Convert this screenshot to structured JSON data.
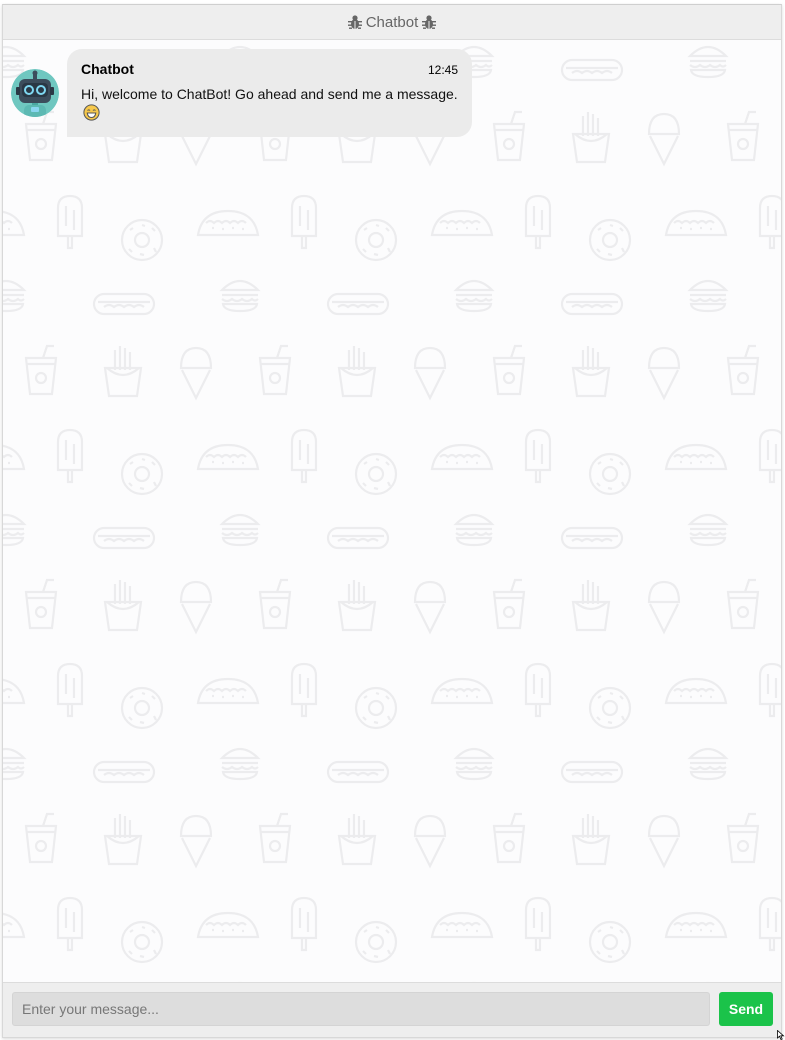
{
  "header": {
    "title": "Chatbot",
    "left_icon": "bug-icon",
    "right_icon": "bug-icon"
  },
  "messages": [
    {
      "sender": "Chatbot",
      "time": "12:45",
      "text": "Hi, welcome to ChatBot! Go ahead and send me a message.",
      "emoji": "smile-emoji",
      "avatar": "robot-avatar"
    }
  ],
  "background": {
    "pattern_icons": [
      "burger-icon",
      "hotdog-icon",
      "cup-icon",
      "fries-icon",
      "ice-cream-cone-icon",
      "popsicle-icon",
      "donut-icon",
      "taco-icon"
    ]
  },
  "composer": {
    "placeholder": "Enter your message...",
    "send_label": "Send"
  },
  "colors": {
    "send_button": "#1bc34a",
    "bubble": "#ebebeb",
    "header": "#eeeeee",
    "pattern": "#ececee"
  }
}
